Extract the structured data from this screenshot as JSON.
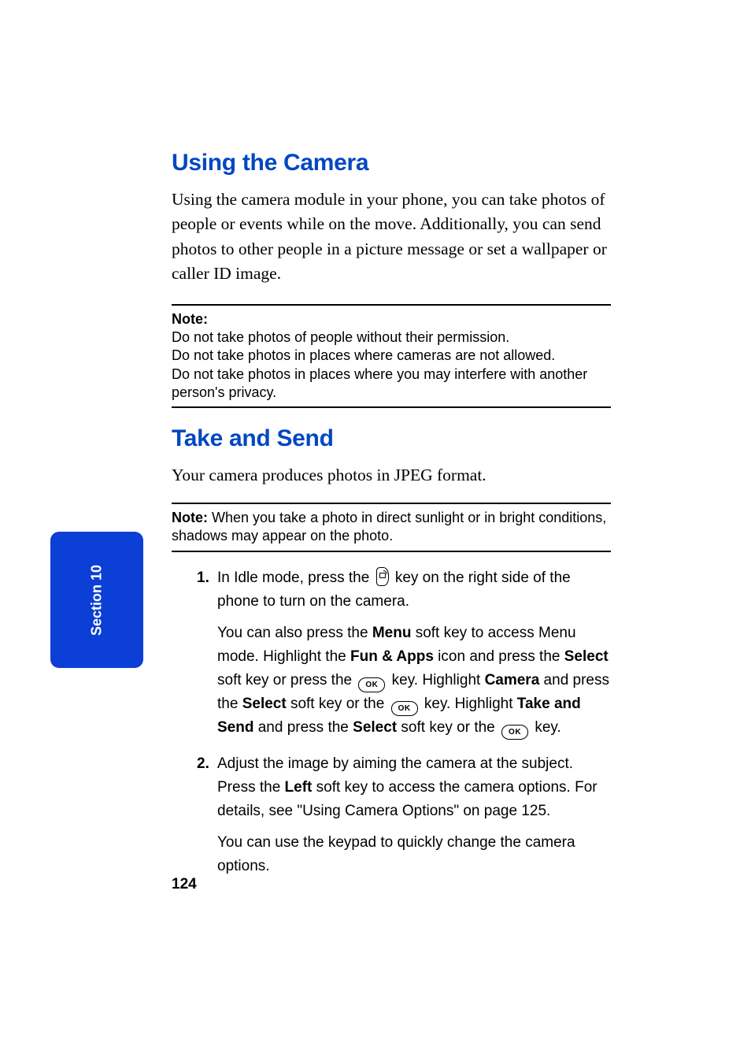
{
  "section_tab": "Section 10",
  "page_number": "124",
  "h1": "Using the Camera",
  "intro": "Using the camera module in your phone, you can take photos of people or events while on the move. Additionally, you can send photos to other people in a picture message or set a wallpaper or caller ID image.",
  "note1_label": "Note:",
  "note1_lines": {
    "l1": "Do not take photos of people without their permission.",
    "l2": "Do not take photos in places where cameras are not allowed.",
    "l3": "Do not take photos in places where you may interfere with another person's privacy."
  },
  "h2": "Take and Send",
  "p2": "Your camera produces photos in JPEG format.",
  "note2_label": "Note:",
  "note2_text": " When you take a photo in direct sunlight or in bright conditions, shadows may appear on the photo.",
  "steps": {
    "s1": {
      "num": "1.",
      "a1": "In Idle mode, press the ",
      "a2": " key on the right side of the phone to turn on the camera.",
      "b1": "You can also press the ",
      "b_menu": "Menu",
      "b2": " soft key to access Menu mode. Highlight the ",
      "b_fun": "Fun & Apps",
      "b3": " icon and press the ",
      "b_select1": "Select",
      "b4": " soft key or press the ",
      "b5": " key. Highlight ",
      "b_camera": "Camera",
      "b6": " and press the ",
      "b_select2": "Select",
      "b7": " soft key or the ",
      "b8": " key. Highlight ",
      "b_take": "Take and Send",
      "b9": " and press the ",
      "b_select3": "Select",
      "b10": " soft key or the ",
      "b11": " key."
    },
    "s2": {
      "num": "2.",
      "a1": "Adjust the image by aiming the camera at the subject. Press the ",
      "a_left": "Left",
      "a2": " soft key to access the camera options. For details, see \"Using Camera Options\" on page 125.",
      "a3": "You can use the keypad to quickly change the camera options."
    }
  },
  "ok_label": "OK"
}
